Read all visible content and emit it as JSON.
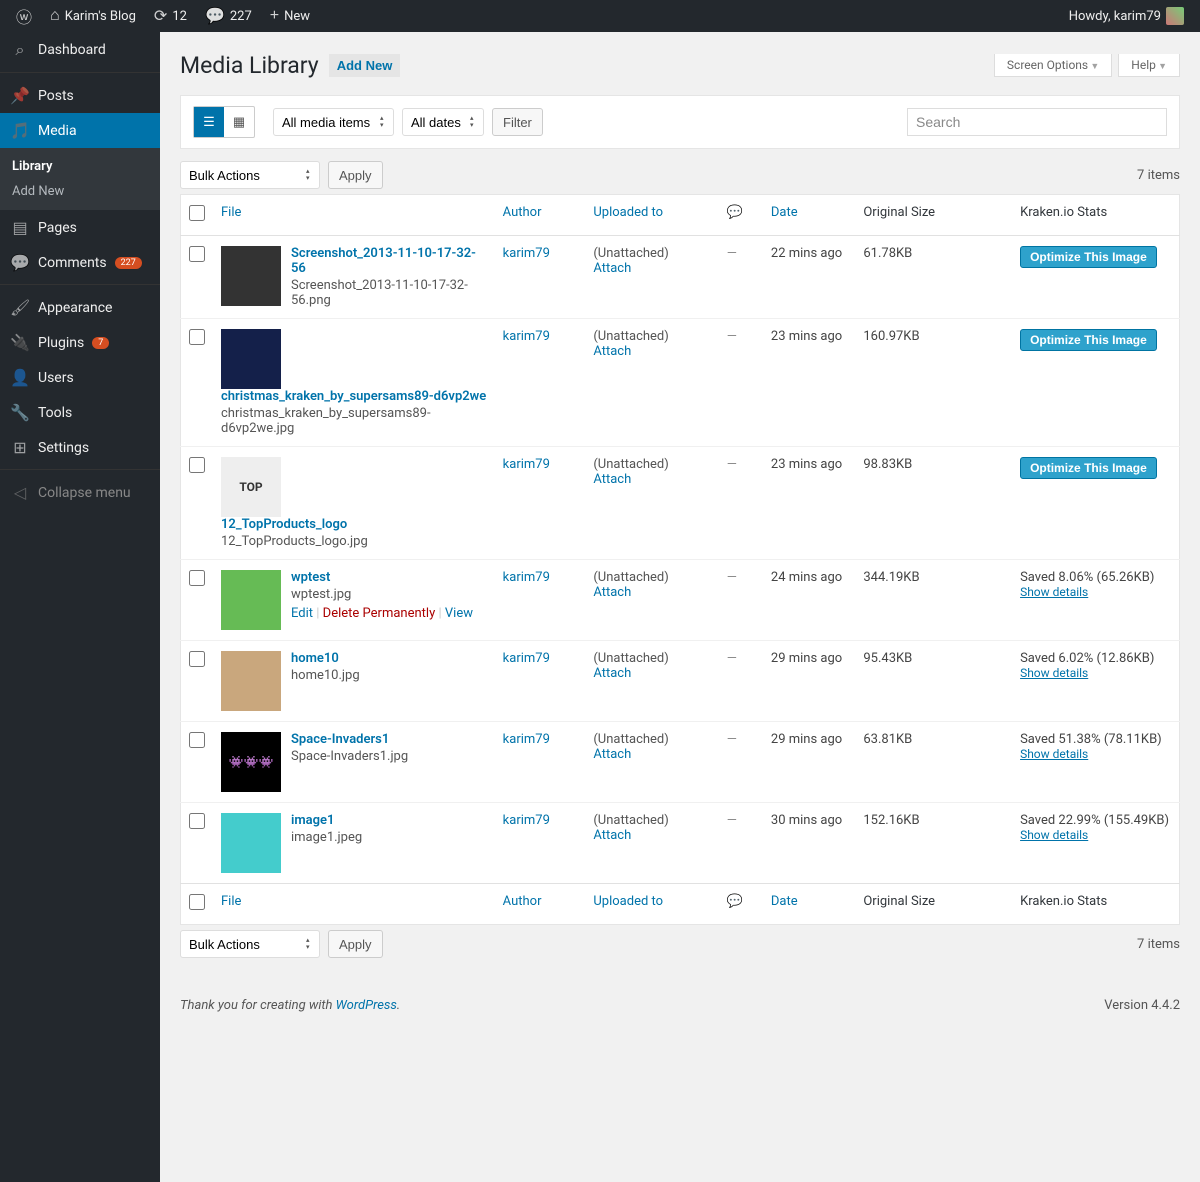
{
  "adminbar": {
    "site_name": "Karim's Blog",
    "updates": "12",
    "comments": "227",
    "new": "New",
    "howdy": "Howdy, karim79"
  },
  "sidebar": {
    "dashboard": "Dashboard",
    "posts": "Posts",
    "media": "Media",
    "media_library": "Library",
    "media_addnew": "Add New",
    "pages": "Pages",
    "comments": "Comments",
    "comments_count": "227",
    "appearance": "Appearance",
    "plugins": "Plugins",
    "plugins_count": "7",
    "users": "Users",
    "tools": "Tools",
    "settings": "Settings",
    "collapse": "Collapse menu"
  },
  "heading": {
    "title": "Media Library",
    "add_new": "Add New",
    "screen_options": "Screen Options",
    "help": "Help"
  },
  "filters": {
    "all_media": "All media items",
    "all_dates": "All dates",
    "filter": "Filter",
    "search_placeholder": "Search"
  },
  "tablenav": {
    "bulk": "Bulk Actions",
    "apply": "Apply",
    "count": "7 items"
  },
  "columns": {
    "file": "File",
    "author": "Author",
    "uploaded_to": "Uploaded to",
    "date": "Date",
    "original_size": "Original Size",
    "kraken": "Kraken.io Stats"
  },
  "labels": {
    "unattached": "(Unattached)",
    "attach": "Attach",
    "optimize": "Optimize This Image",
    "show_details": "Show details",
    "edit": "Edit",
    "delete_permanently": "Delete Permanently",
    "view": "View"
  },
  "rows": [
    {
      "title": "Screenshot_2013-11-10-17-32-56",
      "filename": "Screenshot_2013-11-10-17-32-56.png",
      "author": "karim79",
      "date": "22 mins ago",
      "size": "61.78KB",
      "kraken_type": "optimize",
      "thumb_bg": "#333",
      "thumb_note": ""
    },
    {
      "title": "christmas_kraken_by_supersams89-d6vp2we",
      "filename": "christmas_kraken_by_supersams89-d6vp2we.jpg",
      "author": "karim79",
      "date": "23 mins ago",
      "size": "160.97KB",
      "kraken_type": "optimize",
      "thumb_bg": "#14204a",
      "thumb_note": "",
      "title_below": true
    },
    {
      "title": "12_TopProducts_logo",
      "filename": "12_TopProducts_logo.jpg",
      "author": "karim79",
      "date": "23 mins ago",
      "size": "98.83KB",
      "kraken_type": "optimize",
      "thumb_bg": "#eee",
      "thumb_note": "TOP",
      "title_below": true
    },
    {
      "title": "wptest",
      "filename": "wptest.jpg",
      "author": "karim79",
      "date": "24 mins ago",
      "size": "344.19KB",
      "kraken_type": "saved",
      "kraken_text": "Saved 8.06% (65.26KB)",
      "thumb_bg": "#6b5",
      "thumb_note": "",
      "show_actions": true
    },
    {
      "title": "home10",
      "filename": "home10.jpg",
      "author": "karim79",
      "date": "29 mins ago",
      "size": "95.43KB",
      "kraken_type": "saved",
      "kraken_text": "Saved 6.02% (12.86KB)",
      "thumb_bg": "#c9a77d",
      "thumb_note": ""
    },
    {
      "title": "Space-Invaders1",
      "filename": "Space-Invaders1.jpg",
      "author": "karim79",
      "date": "29 mins ago",
      "size": "63.81KB",
      "kraken_type": "saved",
      "kraken_text": "Saved 51.38% (78.11KB)",
      "thumb_bg": "#000",
      "thumb_note": "👾👾👾"
    },
    {
      "title": "image1",
      "filename": "image1.jpeg",
      "author": "karim79",
      "date": "30 mins ago",
      "size": "152.16KB",
      "kraken_type": "saved",
      "kraken_text": "Saved 22.99% (155.49KB)",
      "thumb_bg": "#4cc",
      "thumb_note": ""
    }
  ],
  "footer": {
    "thanks_prefix": "Thank you for creating with ",
    "wp": "WordPress",
    "version": "Version 4.4.2"
  }
}
